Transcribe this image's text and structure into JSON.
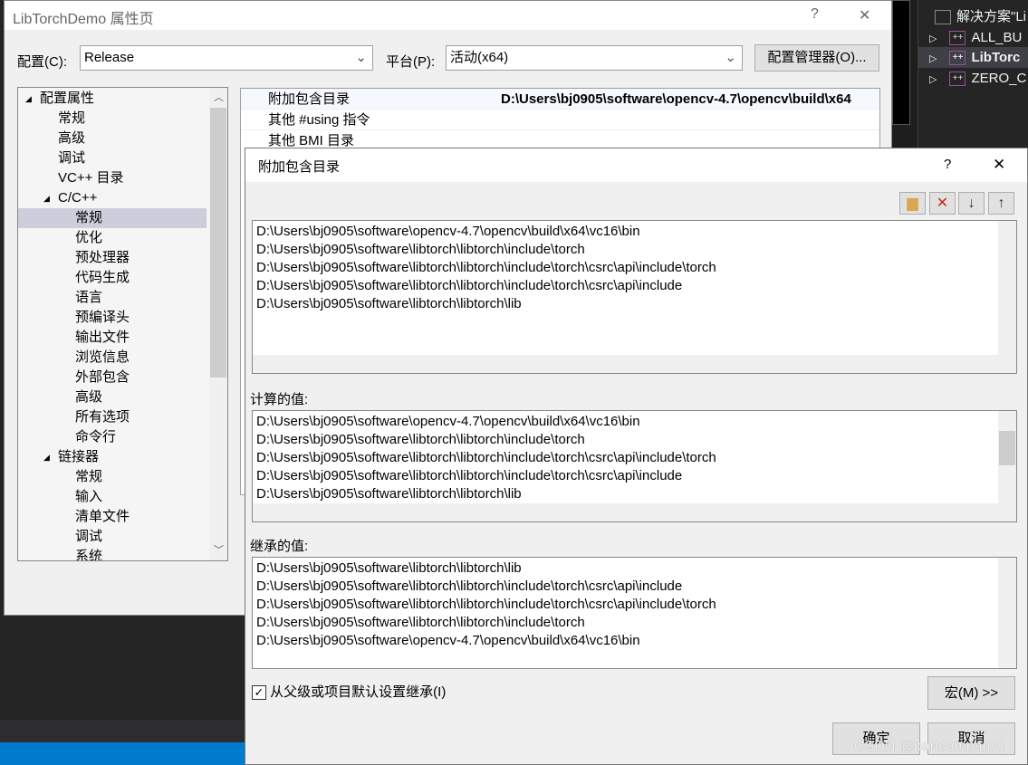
{
  "property_window": {
    "title": "LibTorchDemo 属性页",
    "help": "?",
    "close": "✕",
    "config_label": "配置(C):",
    "config_value": "Release",
    "platform_label": "平台(P):",
    "platform_value": "活动(x64)",
    "config_manager": "配置管理器(O)...",
    "tree": [
      {
        "label": "配置属性",
        "level": 0,
        "expand": "◢"
      },
      {
        "label": "常规",
        "level": 1
      },
      {
        "label": "高级",
        "level": 1
      },
      {
        "label": "调试",
        "level": 1
      },
      {
        "label": "VC++ 目录",
        "level": 1
      },
      {
        "label": "C/C++",
        "level": 1,
        "expand": "◢"
      },
      {
        "label": "常规",
        "level": 2,
        "selected": true
      },
      {
        "label": "优化",
        "level": 2
      },
      {
        "label": "预处理器",
        "level": 2
      },
      {
        "label": "代码生成",
        "level": 2
      },
      {
        "label": "语言",
        "level": 2
      },
      {
        "label": "预编译头",
        "level": 2
      },
      {
        "label": "输出文件",
        "level": 2
      },
      {
        "label": "浏览信息",
        "level": 2
      },
      {
        "label": "外部包含",
        "level": 2
      },
      {
        "label": "高级",
        "level": 2
      },
      {
        "label": "所有选项",
        "level": 2
      },
      {
        "label": "命令行",
        "level": 2
      },
      {
        "label": "链接器",
        "level": 1,
        "expand": "◢"
      },
      {
        "label": "常规",
        "level": 2
      },
      {
        "label": "输入",
        "level": 2
      },
      {
        "label": "清单文件",
        "level": 2
      },
      {
        "label": "调试",
        "level": 2
      },
      {
        "label": "系统",
        "level": 2
      }
    ],
    "grid": [
      {
        "name": "附加包含目录",
        "value": "D:\\Users\\bj0905\\software\\opencv-4.7\\opencv\\build\\x64"
      },
      {
        "name": "其他 #using 指令",
        "value": ""
      },
      {
        "name": "其他 BMI 目录",
        "value": ""
      }
    ]
  },
  "solution_explorer": {
    "items": [
      {
        "label": "解决方案\"Li",
        "icon": "solution-icon"
      },
      {
        "label": "ALL_BU",
        "icon": "project-icon"
      },
      {
        "label": "LibTorc",
        "icon": "project-icon",
        "selected": true
      },
      {
        "label": "ZERO_C",
        "icon": "project-icon"
      }
    ]
  },
  "dialog": {
    "title": "附加包含目录",
    "help": "?",
    "close": "✕",
    "toolbar": [
      {
        "icon": "new-folder-icon",
        "glyph": "📁"
      },
      {
        "icon": "delete-icon",
        "glyph": "✕"
      },
      {
        "icon": "move-down-icon",
        "glyph": "↓"
      },
      {
        "icon": "move-up-icon",
        "glyph": "↑"
      }
    ],
    "entries": [
      "D:\\Users\\bj0905\\software\\opencv-4.7\\opencv\\build\\x64\\vc16\\bin",
      "D:\\Users\\bj0905\\software\\libtorch\\libtorch\\include\\torch",
      "D:\\Users\\bj0905\\software\\libtorch\\libtorch\\include\\torch\\csrc\\api\\include\\torch",
      "D:\\Users\\bj0905\\software\\libtorch\\libtorch\\include\\torch\\csrc\\api\\include",
      "D:\\Users\\bj0905\\software\\libtorch\\libtorch\\lib"
    ],
    "evaluated_label": "计算的值:",
    "evaluated": [
      "D:\\Users\\bj0905\\software\\opencv-4.7\\opencv\\build\\x64\\vc16\\bin",
      "D:\\Users\\bj0905\\software\\libtorch\\libtorch\\include\\torch",
      "D:\\Users\\bj0905\\software\\libtorch\\libtorch\\include\\torch\\csrc\\api\\include\\torch",
      "D:\\Users\\bj0905\\software\\libtorch\\libtorch\\include\\torch\\csrc\\api\\include",
      "D:\\Users\\bj0905\\software\\libtorch\\libtorch\\lib"
    ],
    "inherited_label": "继承的值:",
    "inherited": [
      "D:\\Users\\bj0905\\software\\libtorch\\libtorch\\lib",
      "D:\\Users\\bj0905\\software\\libtorch\\libtorch\\include\\torch\\csrc\\api\\include",
      "D:\\Users\\bj0905\\software\\libtorch\\libtorch\\include\\torch\\csrc\\api\\include\\torch",
      "D:\\Users\\bj0905\\software\\libtorch\\libtorch\\include\\torch",
      "D:\\Users\\bj0905\\software\\opencv-4.7\\opencv\\build\\x64\\vc16\\bin"
    ],
    "inherit_checkbox": {
      "label": "从父级或项目默认设置继承(I)",
      "checked": true
    },
    "macros_button": "宏(M) >>",
    "ok_button": "确定",
    "cancel_button": "取消"
  },
  "watermark": "CSDN @partcompany1",
  "colors": {
    "accent": "#007acc",
    "dark_bg": "#252526",
    "dialog_bg": "#f0f0f0",
    "tree_selected": "#cccedb"
  }
}
